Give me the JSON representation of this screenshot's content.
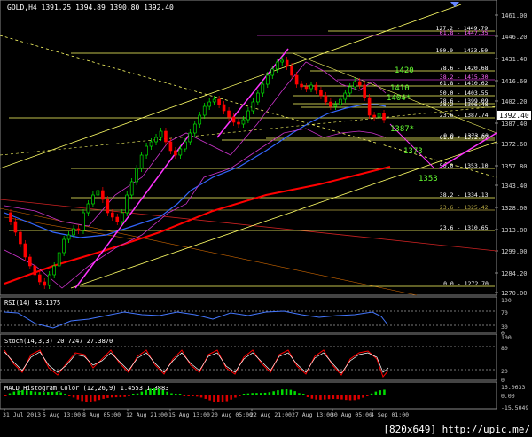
{
  "symbol_header": "GOLD,H4  1391.25 1394.89 1390.80 1392.40",
  "current_price_tag": "1392.40",
  "price_axis": [
    "1461.00",
    "1446.20",
    "1431.40",
    "1416.60",
    "1402.20",
    "1387.40",
    "1372.60",
    "1357.80",
    "1343.40",
    "1328.60",
    "1313.80",
    "1299.00",
    "1284.20",
    "1270.00"
  ],
  "fib_labels_upper": [
    {
      "text": "127.2 - 1449.79",
      "color": "#ffffff"
    },
    {
      "text": "61.8 - 1447.35",
      "color": "#ff66ff"
    },
    {
      "text": "100.0 - 1433.50",
      "color": "#ffffff"
    },
    {
      "text": "78.6 - 1420.68",
      "color": "#ffffff"
    },
    {
      "text": "38.2 - 1415.30",
      "color": "#ff66ff"
    },
    {
      "text": "61.8 - 1410.62",
      "color": "#ffffff"
    },
    {
      "text": "50.0 - 1403.55",
      "color": "#ffffff"
    },
    {
      "text": "78.6 - 1399.09",
      "color": "#ffffff"
    },
    {
      "text": "38.2 - 1396.48",
      "color": "#ffffff"
    },
    {
      "text": "23.6 - 1387.74",
      "color": "#ffffff"
    },
    {
      "text": "0.0 - 1373.60",
      "color": "#ffffff"
    },
    {
      "text": "61.8 - 1372.07",
      "color": "#ffffff"
    },
    {
      "text": "50.0 - 1353.10",
      "color": "#ffffff"
    },
    {
      "text": "38.2 - 1334.13",
      "color": "#ffffff"
    },
    {
      "text": "23.6 - 1325.42",
      "color": "#b5a642"
    },
    {
      "text": "23.6 - 1310.65",
      "color": "#ffffff"
    },
    {
      "text": "0.0 - 1272.70",
      "color": "#ffffff"
    }
  ],
  "green_levels": [
    "1420",
    "1410",
    "1404*",
    "1387*",
    "1373",
    "1353"
  ],
  "rsi": {
    "label": "RSI(14) 43.1375",
    "levels": [
      "100",
      "70",
      "30",
      "0"
    ]
  },
  "stoch": {
    "label": "Stoch(14,3,3) 20.7247 27.3870",
    "levels": [
      "100",
      "80",
      "20",
      "0"
    ]
  },
  "macd": {
    "label": "MACD_Histogram_Color (12,26,9) 1.4553 1.3883",
    "levels": [
      "16.0633",
      "0.00",
      "-15.5049"
    ]
  },
  "time_axis": [
    "31 Jul 2013",
    "5 Aug 13:00",
    "8 Aug 05:00",
    "12 Aug 21:00",
    "15 Aug 13:00",
    "20 Aug 05:00",
    "22 Aug 21:00",
    "27 Aug 13:00",
    "30 Aug 05:00",
    "4 Sep 01:00"
  ],
  "watermark": "[820x649] http://upic.me/",
  "colors": {
    "up": "#00ff00",
    "down": "#ff0000",
    "fib": "#ffff66",
    "pink": "#cc33cc",
    "blue_ma": "#3366ff",
    "red_ma": "#ff0000"
  }
}
